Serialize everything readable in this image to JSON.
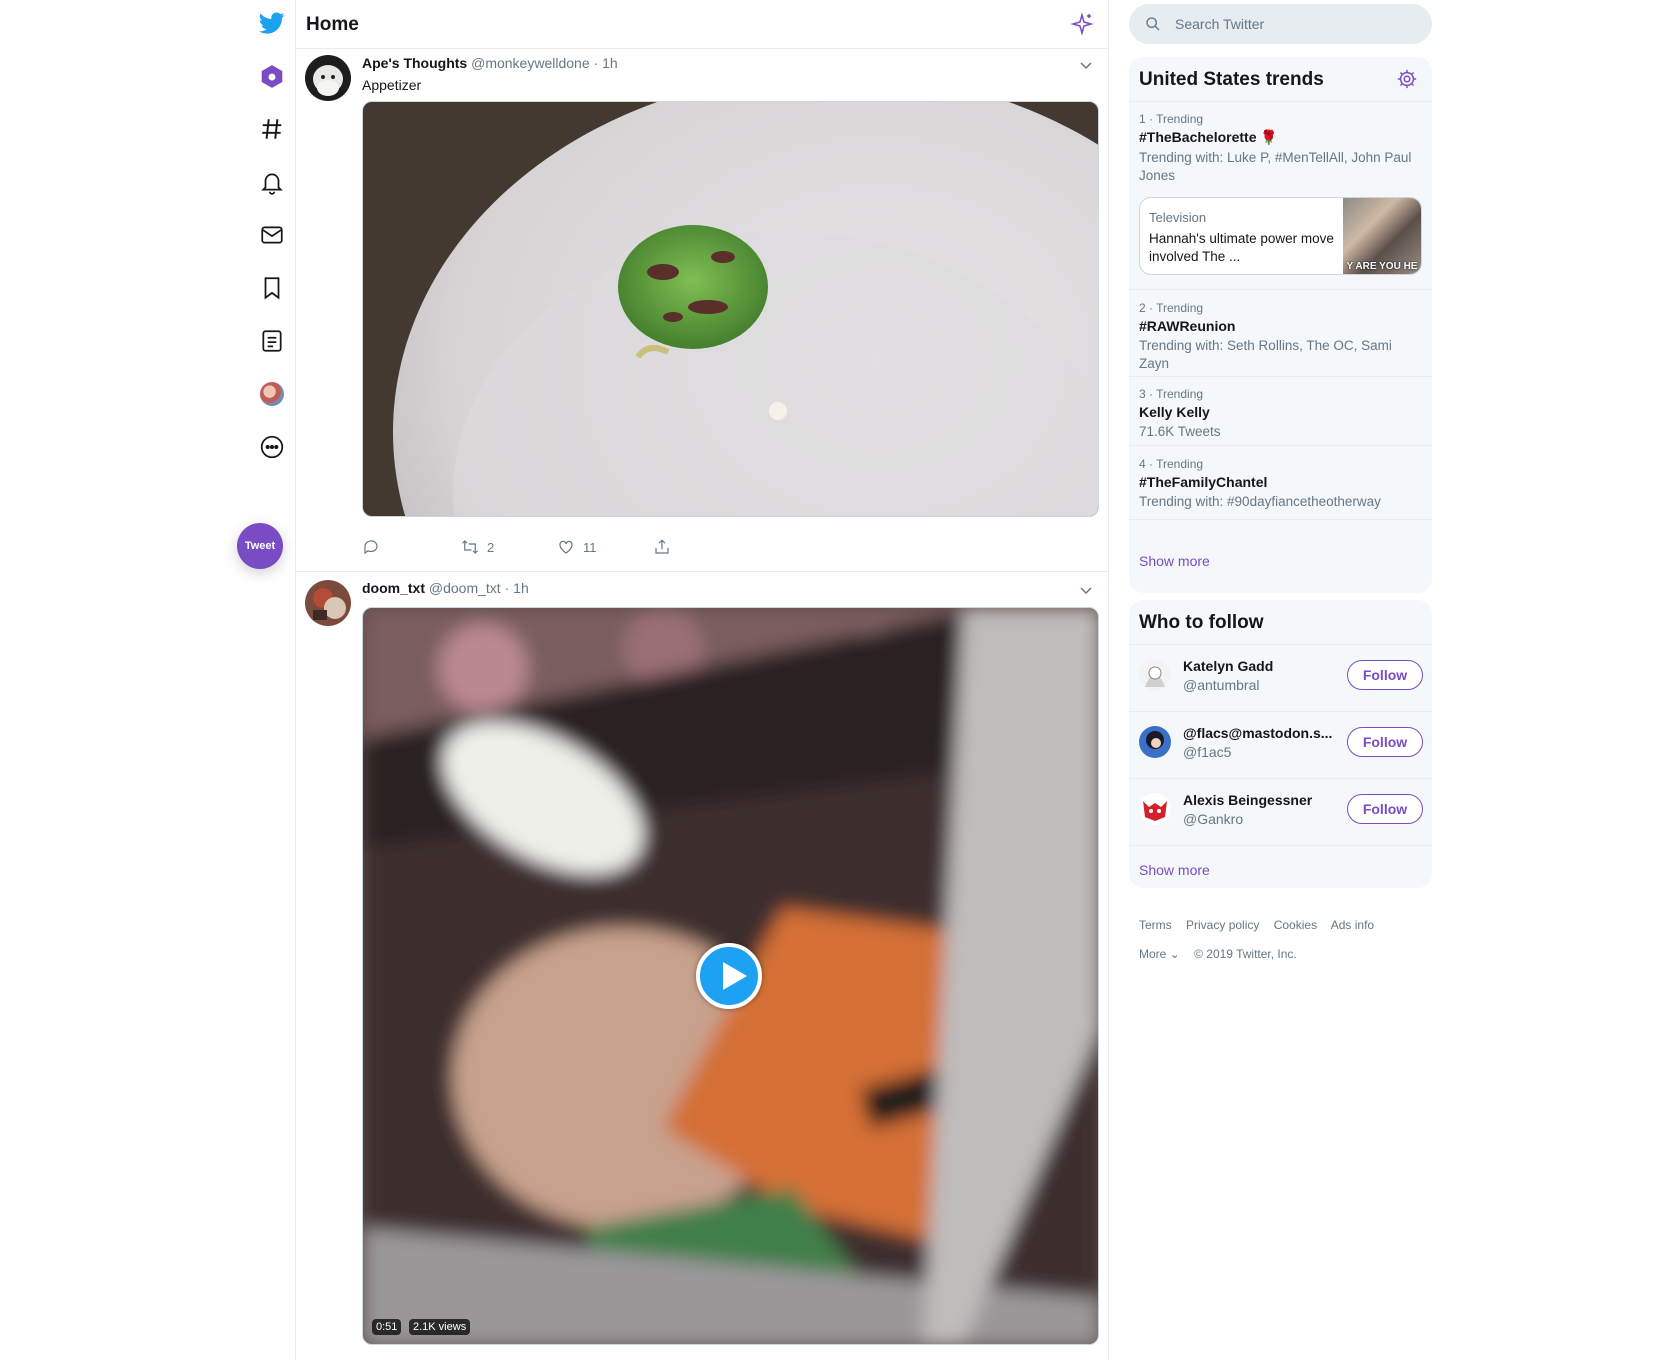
{
  "nav": {
    "items": [
      "twitter-logo",
      "home",
      "explore",
      "notifications",
      "messages",
      "bookmarks",
      "lists",
      "profile",
      "more"
    ],
    "tweet_button": "Tweet"
  },
  "header": {
    "title": "Home"
  },
  "tweets": [
    {
      "name": "Ape's Thoughts",
      "handle": "@monkeywelldone",
      "separator": "·",
      "time": "1h",
      "text": "Appetizer",
      "retweets": "2",
      "likes": "11"
    },
    {
      "name": "doom_txt",
      "handle": "@doom_txt",
      "separator": "·",
      "time": "1h",
      "video_duration": "0:51",
      "video_views": "2.1K views"
    }
  ],
  "search": {
    "placeholder": "Search Twitter"
  },
  "trends": {
    "title": "United States trends",
    "items": [
      {
        "meta": "1 · Trending",
        "name": "#TheBachelorette 🌹",
        "sub": "Trending with: Luke P, #MenTellAll, John Paul Jones"
      },
      {
        "meta": "2 · Trending",
        "name": "#RAWReunion",
        "sub": "Trending with: Seth Rollins, The OC, Sami Zayn"
      },
      {
        "meta": "3 · Trending",
        "name": "Kelly Kelly",
        "sub": "71.6K Tweets"
      },
      {
        "meta": "4 · Trending",
        "name": "#TheFamilyChantel",
        "sub": "Trending with: #90dayfiancetheotherway"
      }
    ],
    "news": {
      "category": "Television",
      "headline": "Hannah's ultimate power move involved The ...",
      "thumb_caption": "Y ARE YOU HE"
    },
    "show_more": "Show more"
  },
  "who_to_follow": {
    "title": "Who to follow",
    "users": [
      {
        "name": "Katelyn Gadd",
        "handle": "@antumbral",
        "button": "Follow"
      },
      {
        "name": "@flacs@mastodon.s...",
        "handle": "@f1ac5",
        "button": "Follow"
      },
      {
        "name": "Alexis Beingessner",
        "handle": "@Gankro",
        "button": "Follow"
      }
    ],
    "show_more": "Show more"
  },
  "footer": {
    "links": [
      "Terms",
      "Privacy policy",
      "Cookies",
      "Ads info"
    ],
    "more": "More",
    "copyright": "© 2019 Twitter, Inc."
  },
  "colors": {
    "accent": "#794bc4",
    "logo": "#1da1f2",
    "text": "#14171a",
    "secondary": "#657786"
  }
}
